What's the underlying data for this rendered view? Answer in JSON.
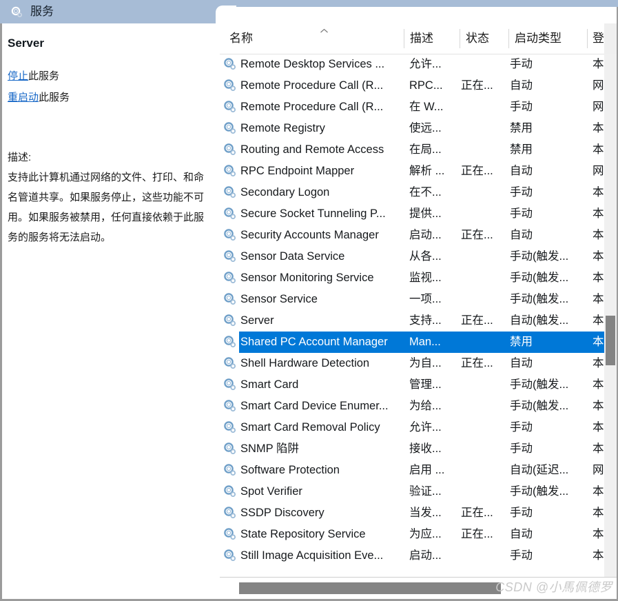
{
  "window": {
    "title": "服务",
    "icon": "services-gear-icon"
  },
  "details": {
    "service_name": "Server",
    "links": [
      {
        "link_text": "停止",
        "suffix": "此服务"
      },
      {
        "link_text": "重启动",
        "suffix": "此服务"
      }
    ],
    "description_label": "描述:",
    "description_body": "支持此计算机通过网络的文件、打印、和命名管道共享。如果服务停止，这些功能不可用。如果服务被禁用，任何直接依赖于此服务的服务将无法启动。"
  },
  "list": {
    "columns": [
      {
        "key": "name",
        "label": "名称",
        "sort": "asc"
      },
      {
        "key": "desc",
        "label": "描述"
      },
      {
        "key": "state",
        "label": "状态"
      },
      {
        "key": "startup",
        "label": "启动类型"
      },
      {
        "key": "logon",
        "label": "登"
      }
    ],
    "sort_arrow": "▲",
    "selected_index": 13,
    "rows": [
      {
        "name": "Remote Desktop Services ...",
        "desc": "允许...",
        "state": "",
        "startup": "手动",
        "logon": "本"
      },
      {
        "name": "Remote Procedure Call (R...",
        "desc": "RPC...",
        "state": "正在...",
        "startup": "自动",
        "logon": "网"
      },
      {
        "name": "Remote Procedure Call (R...",
        "desc": "在 W...",
        "state": "",
        "startup": "手动",
        "logon": "网"
      },
      {
        "name": "Remote Registry",
        "desc": "使远...",
        "state": "",
        "startup": "禁用",
        "logon": "本"
      },
      {
        "name": "Routing and Remote Access",
        "desc": "在局...",
        "state": "",
        "startup": "禁用",
        "logon": "本"
      },
      {
        "name": "RPC Endpoint Mapper",
        "desc": "解析 ...",
        "state": "正在...",
        "startup": "自动",
        "logon": "网"
      },
      {
        "name": "Secondary Logon",
        "desc": "在不...",
        "state": "",
        "startup": "手动",
        "logon": "本"
      },
      {
        "name": "Secure Socket Tunneling P...",
        "desc": "提供...",
        "state": "",
        "startup": "手动",
        "logon": "本"
      },
      {
        "name": "Security Accounts Manager",
        "desc": "启动...",
        "state": "正在...",
        "startup": "自动",
        "logon": "本"
      },
      {
        "name": "Sensor Data Service",
        "desc": "从各...",
        "state": "",
        "startup": "手动(触发...",
        "logon": "本"
      },
      {
        "name": "Sensor Monitoring Service",
        "desc": "监视...",
        "state": "",
        "startup": "手动(触发...",
        "logon": "本"
      },
      {
        "name": "Sensor Service",
        "desc": "一项...",
        "state": "",
        "startup": "手动(触发...",
        "logon": "本"
      },
      {
        "name": "Server",
        "desc": "支持...",
        "state": "正在...",
        "startup": "自动(触发...",
        "logon": "本"
      },
      {
        "name": "Shared PC Account Manager",
        "desc": "Man...",
        "state": "",
        "startup": "禁用",
        "logon": "本"
      },
      {
        "name": "Shell Hardware Detection",
        "desc": "为自...",
        "state": "正在...",
        "startup": "自动",
        "logon": "本"
      },
      {
        "name": "Smart Card",
        "desc": "管理...",
        "state": "",
        "startup": "手动(触发...",
        "logon": "本"
      },
      {
        "name": "Smart Card Device Enumer...",
        "desc": "为给...",
        "state": "",
        "startup": "手动(触发...",
        "logon": "本"
      },
      {
        "name": "Smart Card Removal Policy",
        "desc": "允许...",
        "state": "",
        "startup": "手动",
        "logon": "本"
      },
      {
        "name": "SNMP 陷阱",
        "desc": "接收...",
        "state": "",
        "startup": "手动",
        "logon": "本"
      },
      {
        "name": "Software Protection",
        "desc": "启用 ...",
        "state": "",
        "startup": "自动(延迟...",
        "logon": "网"
      },
      {
        "name": "Spot Verifier",
        "desc": "验证...",
        "state": "",
        "startup": "手动(触发...",
        "logon": "本"
      },
      {
        "name": "SSDP Discovery",
        "desc": "当发...",
        "state": "正在...",
        "startup": "手动",
        "logon": "本"
      },
      {
        "name": "State Repository Service",
        "desc": "为应...",
        "state": "正在...",
        "startup": "自动",
        "logon": "本"
      },
      {
        "name": "Still Image Acquisition Eve...",
        "desc": "启动...",
        "state": "",
        "startup": "手动",
        "logon": "本"
      }
    ]
  },
  "watermark": "CSDN @小馬佩德罗",
  "colors": {
    "titlebar": "#a7bcd6",
    "selection": "#0078d7",
    "link": "#1667c7",
    "scroll_thumb": "#848484"
  }
}
